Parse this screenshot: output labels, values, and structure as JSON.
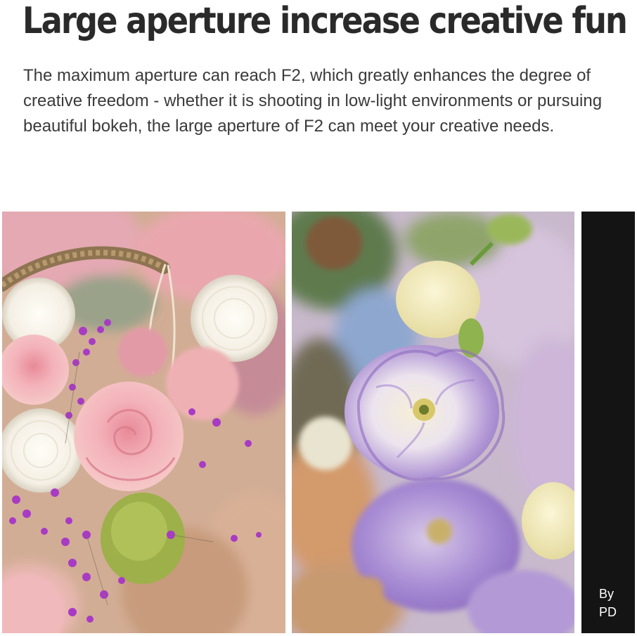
{
  "headline": "Large aperture increase creative fun",
  "description": "The maximum aperture can reach F2, which greatly enhances the degree of creative freedom - whether it is shooting in low-light environments or pursuing beautiful bokeh, the large aperture of F2 can meet your creative needs.",
  "credit": {
    "line1": "By",
    "line2": "PD"
  },
  "colors": {
    "background": "#ffffff",
    "text": "#2a2a2a",
    "credit_panel": "#141414"
  }
}
